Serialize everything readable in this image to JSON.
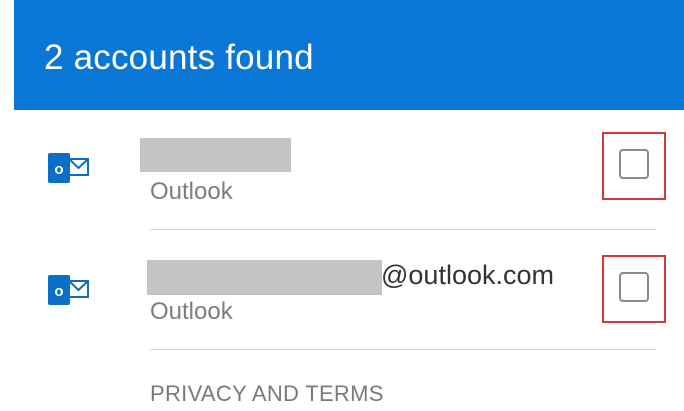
{
  "header": {
    "title": "2 accounts found",
    "color": "#0a76d6"
  },
  "accounts": [
    {
      "icon": "outlook-icon",
      "email_visible_part": "",
      "type": "Outlook",
      "checked": false
    },
    {
      "icon": "outlook-icon",
      "email_visible_part": "@outlook.com",
      "type": "Outlook",
      "checked": false
    }
  ],
  "footer": {
    "privacy_label": "PRIVACY AND TERMS"
  },
  "colors": {
    "highlight_border": "#d23a3a",
    "outlook_blue": "#0a6fc6"
  }
}
